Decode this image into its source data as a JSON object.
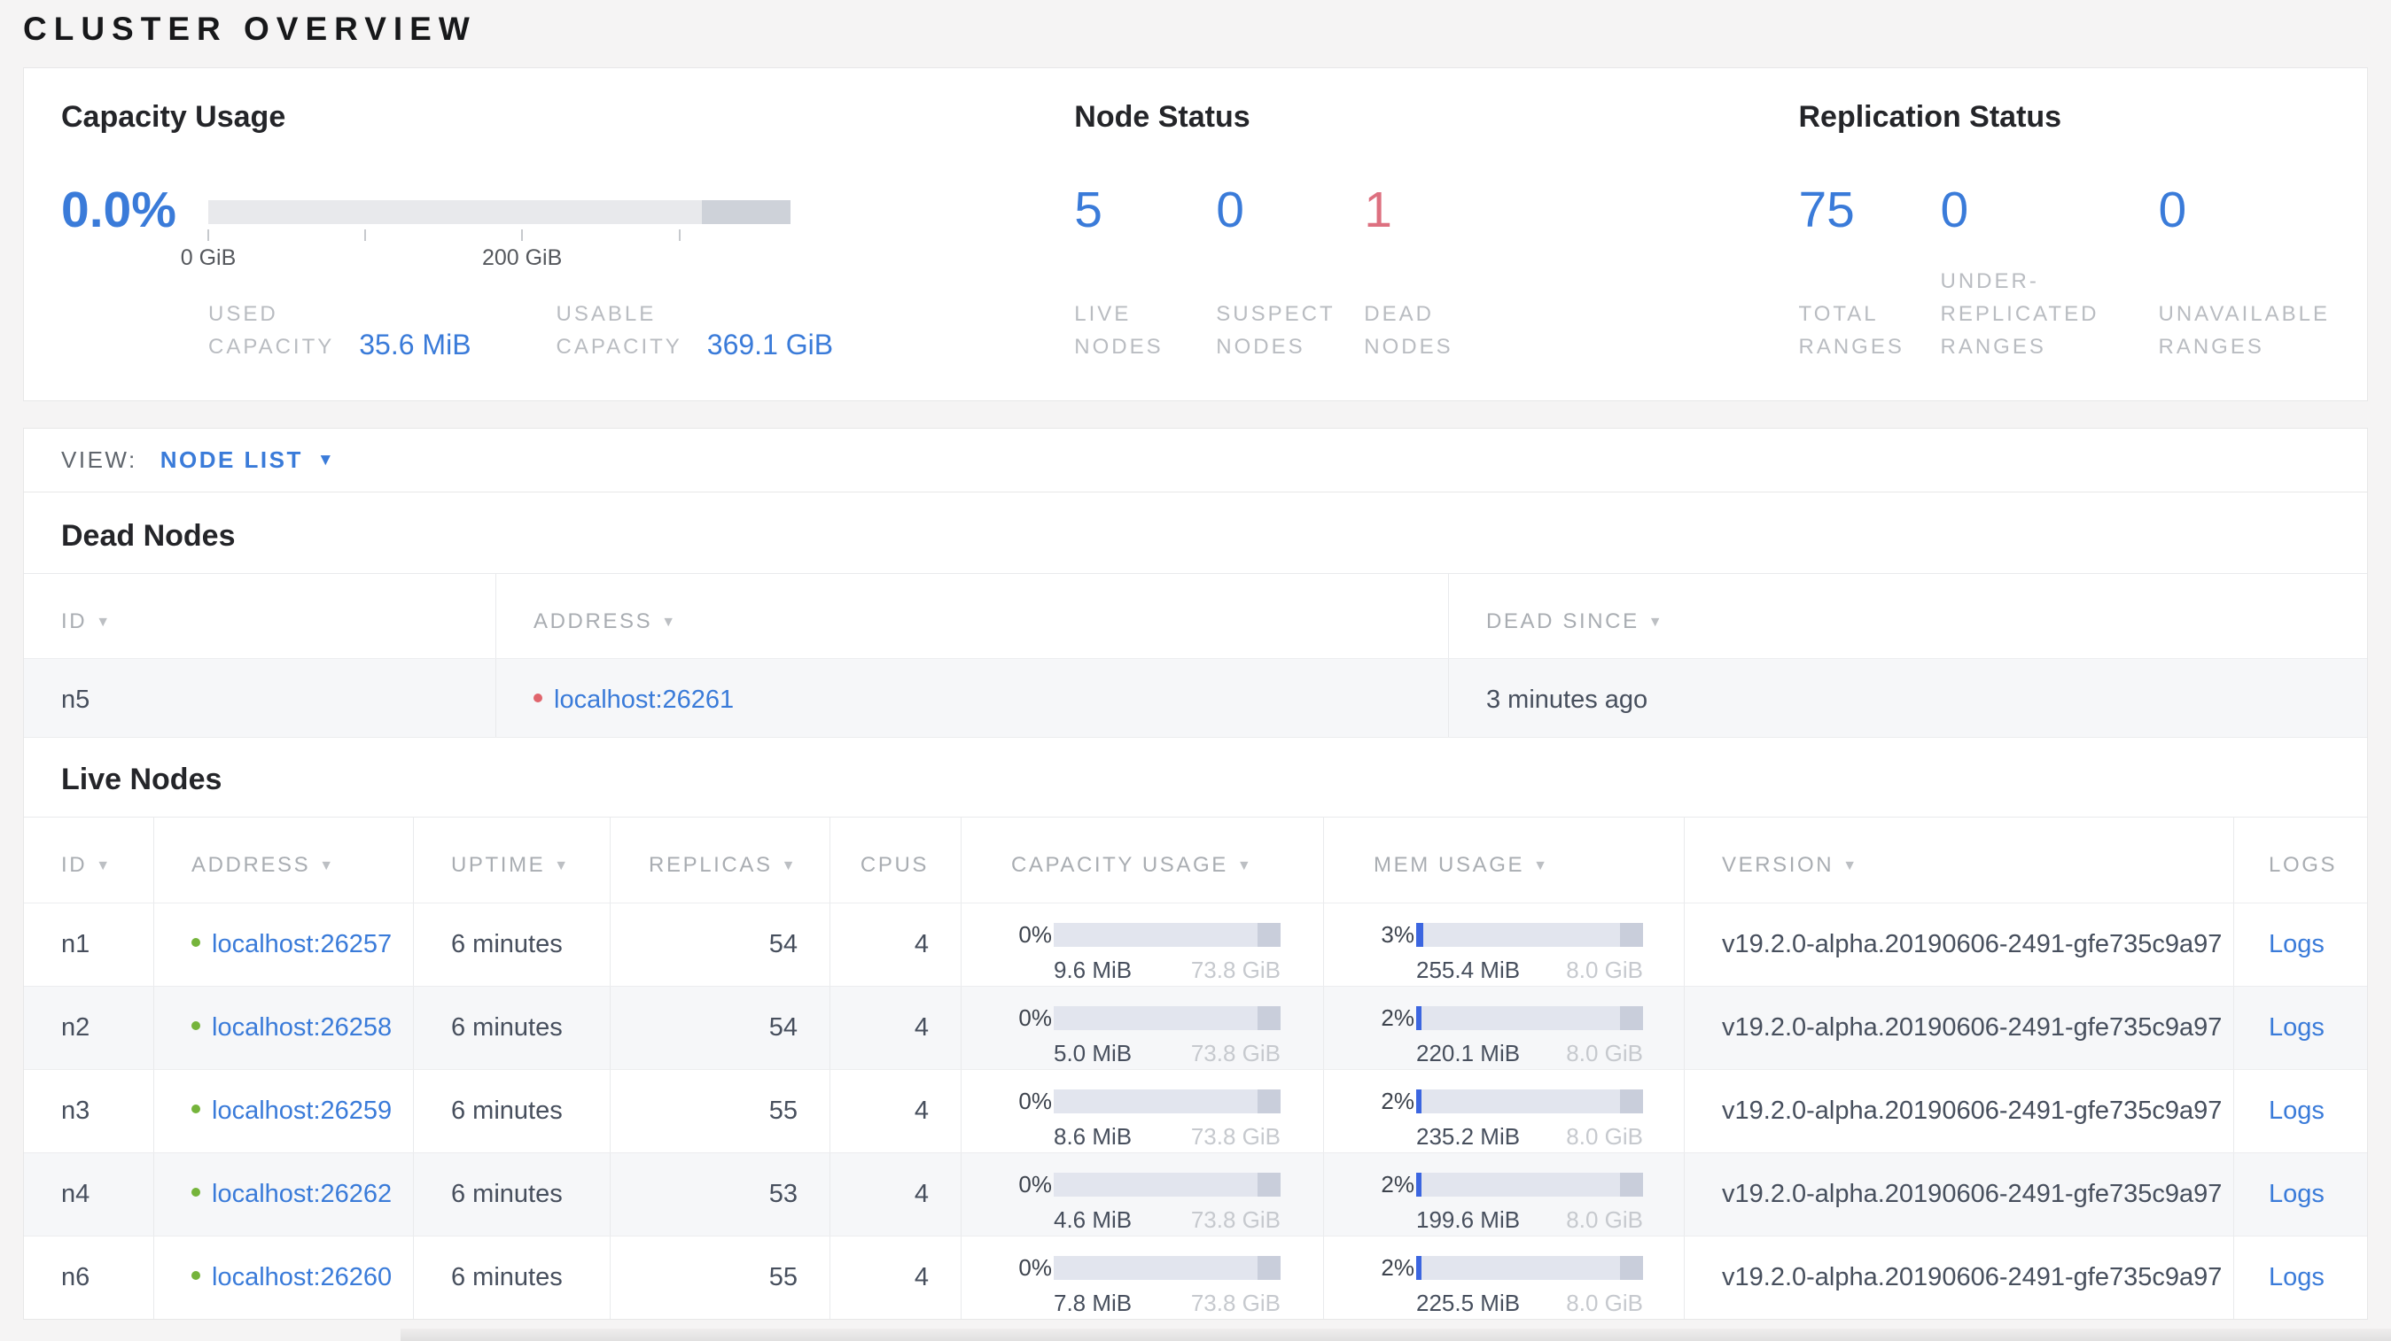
{
  "page": {
    "title": "CLUSTER OVERVIEW"
  },
  "icons": {
    "sort_desc": "▼",
    "caret_down": "▼"
  },
  "colors": {
    "accent_blue": "#3a7bd9",
    "bar_blue": "#3c66e0",
    "danger_red": "#dd7080",
    "live_green": "#75b43b",
    "dead_dot_red": "#e0656d"
  },
  "capacity": {
    "title": "Capacity Usage",
    "percent": "0.0%",
    "ticks": {
      "t0": "0 GiB",
      "t200": "200 GiB"
    },
    "used": {
      "line1": "USED",
      "line2": "CAPACITY",
      "value": "35.6 MiB"
    },
    "usable": {
      "line1": "USABLE",
      "line2": "CAPACITY",
      "value": "369.1 GiB"
    }
  },
  "node_status": {
    "title": "Node Status",
    "live": {
      "value": "5",
      "line1": "LIVE",
      "line2": "NODES"
    },
    "suspect": {
      "value": "0",
      "line1": "SUSPECT",
      "line2": "NODES"
    },
    "dead": {
      "value": "1",
      "line1": "DEAD",
      "line2": "NODES"
    }
  },
  "replication_status": {
    "title": "Replication Status",
    "total": {
      "value": "75",
      "line1": "TOTAL",
      "line2": "RANGES"
    },
    "under": {
      "value": "0",
      "line1": "UNDER-",
      "line2": "REPLICATED",
      "line3": "RANGES"
    },
    "unavailable": {
      "value": "0",
      "line1": "UNAVAILABLE",
      "line2": "RANGES"
    }
  },
  "view_bar": {
    "label": "VIEW:",
    "selected": "NODE LIST"
  },
  "dead_nodes": {
    "heading": "Dead Nodes",
    "columns": {
      "id": "ID",
      "address": "ADDRESS",
      "dead_since": "DEAD SINCE"
    },
    "rows": [
      {
        "id": "n5",
        "address": "localhost:26261",
        "dead_since": "3 minutes ago"
      }
    ]
  },
  "live_nodes": {
    "heading": "Live Nodes",
    "columns": {
      "id": "ID",
      "address": "ADDRESS",
      "uptime": "UPTIME",
      "replicas": "REPLICAS",
      "cpus": "CPUS",
      "capacity": "CAPACITY USAGE",
      "mem": "MEM USAGE",
      "version": "VERSION",
      "logs": "LOGS"
    },
    "rows": [
      {
        "id": "n1",
        "address": "localhost:26257",
        "uptime": "6 minutes",
        "replicas": "54",
        "cpus": "4",
        "cap": {
          "pct_label": "0%",
          "pct": 0,
          "used": "9.6 MiB",
          "total": "73.8 GiB"
        },
        "mem": {
          "pct_label": "3%",
          "pct": 3,
          "used": "255.4 MiB",
          "total": "8.0 GiB"
        },
        "version": "v19.2.0-alpha.20190606-2491-gfe735c9a97",
        "logs": "Logs"
      },
      {
        "id": "n2",
        "address": "localhost:26258",
        "uptime": "6 minutes",
        "replicas": "54",
        "cpus": "4",
        "cap": {
          "pct_label": "0%",
          "pct": 0,
          "used": "5.0 MiB",
          "total": "73.8 GiB"
        },
        "mem": {
          "pct_label": "2%",
          "pct": 2.5,
          "used": "220.1 MiB",
          "total": "8.0 GiB"
        },
        "version": "v19.2.0-alpha.20190606-2491-gfe735c9a97",
        "logs": "Logs"
      },
      {
        "id": "n3",
        "address": "localhost:26259",
        "uptime": "6 minutes",
        "replicas": "55",
        "cpus": "4",
        "cap": {
          "pct_label": "0%",
          "pct": 0,
          "used": "8.6 MiB",
          "total": "73.8 GiB"
        },
        "mem": {
          "pct_label": "2%",
          "pct": 2.5,
          "used": "235.2 MiB",
          "total": "8.0 GiB"
        },
        "version": "v19.2.0-alpha.20190606-2491-gfe735c9a97",
        "logs": "Logs"
      },
      {
        "id": "n4",
        "address": "localhost:26262",
        "uptime": "6 minutes",
        "replicas": "53",
        "cpus": "4",
        "cap": {
          "pct_label": "0%",
          "pct": 0,
          "used": "4.6 MiB",
          "total": "73.8 GiB"
        },
        "mem": {
          "pct_label": "2%",
          "pct": 2.5,
          "used": "199.6 MiB",
          "total": "8.0 GiB"
        },
        "version": "v19.2.0-alpha.20190606-2491-gfe735c9a97",
        "logs": "Logs"
      },
      {
        "id": "n6",
        "address": "localhost:26260",
        "uptime": "6 minutes",
        "replicas": "55",
        "cpus": "4",
        "cap": {
          "pct_label": "0%",
          "pct": 0,
          "used": "7.8 MiB",
          "total": "73.8 GiB"
        },
        "mem": {
          "pct_label": "2%",
          "pct": 2.5,
          "used": "225.5 MiB",
          "total": "8.0 GiB"
        },
        "version": "v19.2.0-alpha.20190606-2491-gfe735c9a97",
        "logs": "Logs"
      }
    ]
  }
}
